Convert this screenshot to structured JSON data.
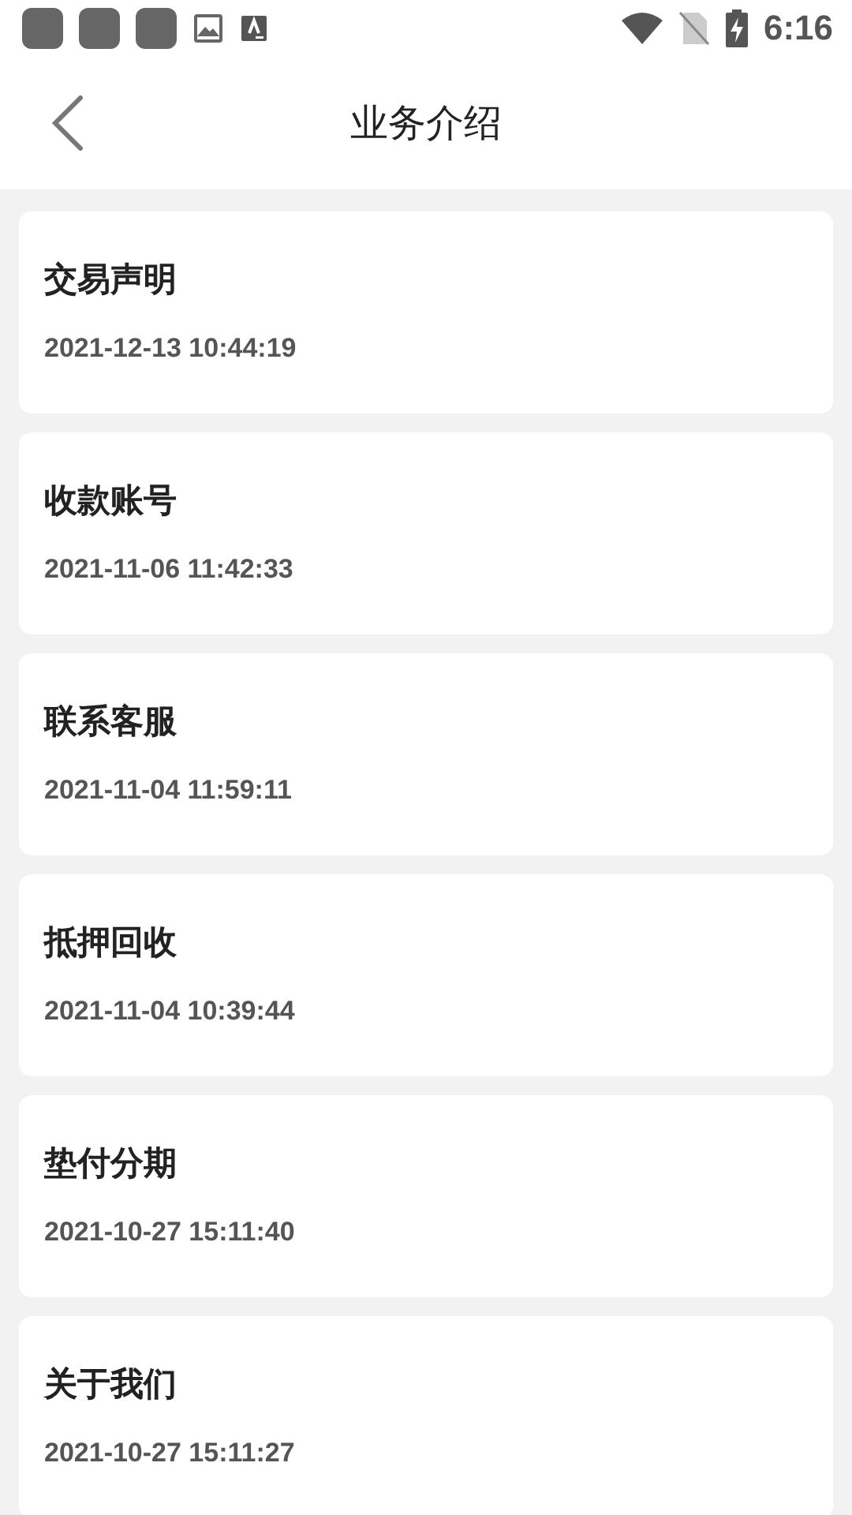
{
  "status_bar": {
    "time": "6:16"
  },
  "header": {
    "title": "业务介绍"
  },
  "items": [
    {
      "title": "交易声明",
      "date": "2021-12-13 10:44:19"
    },
    {
      "title": "收款账号",
      "date": "2021-11-06 11:42:33"
    },
    {
      "title": "联系客服",
      "date": "2021-11-04 11:59:11"
    },
    {
      "title": "抵押回收",
      "date": "2021-11-04 10:39:44"
    },
    {
      "title": "垫付分期",
      "date": "2021-10-27 15:11:40"
    },
    {
      "title": "关于我们",
      "date": "2021-10-27 15:11:27"
    }
  ]
}
